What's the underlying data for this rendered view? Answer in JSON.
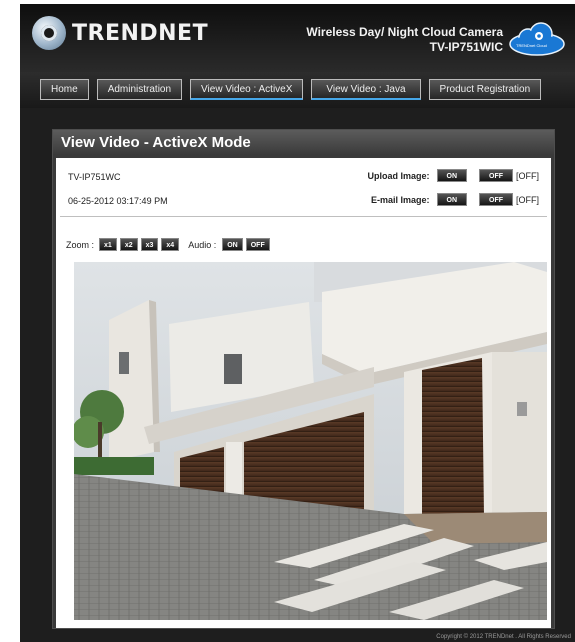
{
  "brand": {
    "logo_text": "TRENDNET",
    "product_line1": "Wireless Day/ Night Cloud Camera",
    "product_line2": "TV-IP751WIC",
    "cloud_badge": "TRENDnet Cloud"
  },
  "nav": {
    "items": [
      {
        "label": "Home"
      },
      {
        "label": "Administration"
      },
      {
        "label": "View Video : ActiveX"
      },
      {
        "label": "View Video : Java"
      },
      {
        "label": "Product Registration"
      }
    ],
    "active_index": 2
  },
  "panel": {
    "title": "View Video - ActiveX Mode",
    "camera_name": "TV-IP751WC",
    "datetime": "06-25-2012 03:17:49 PM",
    "upload_label": "Upload Image:",
    "email_label": "E-mail Image:",
    "on_label": "ON",
    "off_label": "OFF",
    "upload_state": "[OFF]",
    "email_state": "[OFF]",
    "zoom_label": "Zoom :",
    "zoom_options": [
      "x1",
      "x2",
      "x3",
      "x4"
    ],
    "audio_label": "Audio :",
    "audio_on": "ON",
    "audio_off": "OFF"
  },
  "footer": {
    "copyright": "Copyright © 2012 TRENDnet . All Rights Reserved"
  },
  "colors": {
    "accent": "#46a7e8",
    "header_bg": "#1e1e1e",
    "panel_bg": "#3a3a3a"
  }
}
